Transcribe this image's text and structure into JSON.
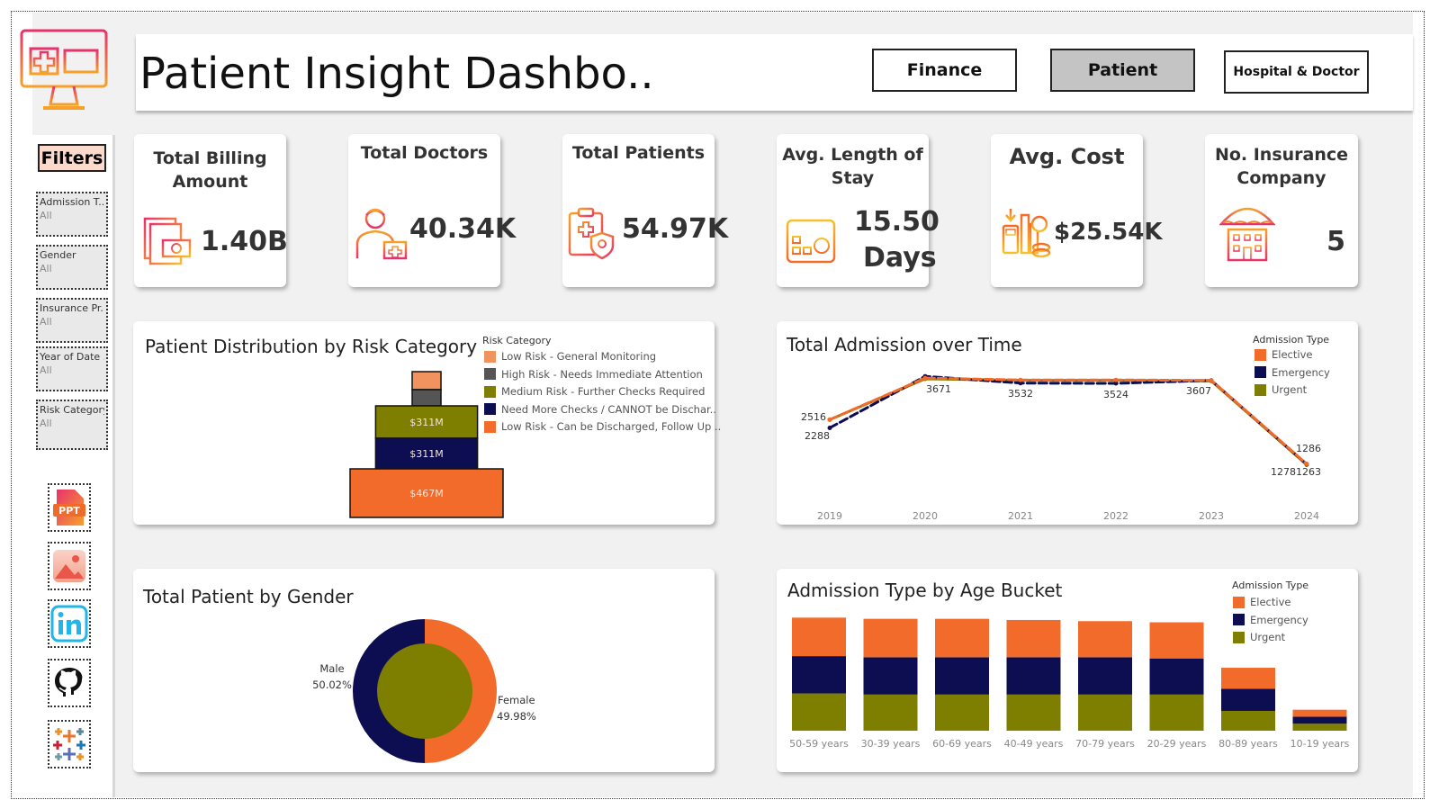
{
  "header": {
    "title": "Patient Insight Dashbo..",
    "nav": [
      {
        "label": "Finance",
        "bg": "#fbd9cb"
      },
      {
        "label": "Patient",
        "bg": "#c4c4c4"
      },
      {
        "label": "Hospital & Doctor",
        "bg": "#fbd9cb"
      }
    ]
  },
  "sidebar": {
    "filters_title": "Filters",
    "filters": [
      {
        "label": "Admission T..",
        "value": "All"
      },
      {
        "label": "Gender",
        "value": "All"
      },
      {
        "label": "Insurance Pr..",
        "value": "All"
      },
      {
        "label": "Year of Date ..",
        "value": "All"
      },
      {
        "label": "Risk Category",
        "value": "All"
      }
    ],
    "links": [
      "ppt-icon",
      "image-icon",
      "linkedin-icon",
      "github-icon",
      "tableau-icon"
    ]
  },
  "kpis": [
    {
      "label": "Total Billing Amount",
      "value": "1.40B",
      "icon": "billing-icon"
    },
    {
      "label": "Total Doctors",
      "value": "40.34K",
      "icon": "doctor-icon"
    },
    {
      "label": "Total Patients",
      "value": "54.97K",
      "icon": "patient-icon"
    },
    {
      "label": "Avg. Length of Stay",
      "value": "15.50",
      "value2": "Days",
      "icon": "calendar-icon"
    },
    {
      "label": "Avg. Cost",
      "value": "$25.54K",
      "icon": "cost-icon"
    },
    {
      "label": "No. Insurance Company",
      "value": "5",
      "icon": "insurance-icon"
    }
  ],
  "colors": {
    "orange": "#f26b2a",
    "light_orange": "#f0935e",
    "gray": "#555555",
    "olive": "#7e7e00",
    "navy": "#0d0d52"
  },
  "chart_data": [
    {
      "type": "bar",
      "title": "Patient Distribution by Risk Category",
      "legend_title": "Risk Category",
      "categories": [
        "Low Risk - General Monitoring",
        "High Risk - Needs Immediate Attention",
        "Medium Risk - Further Checks Required",
        "Need More Checks / CANNOT be Dischar..",
        "Low Risk - Can be Discharged, Follow Up .."
      ],
      "colors": [
        "#f0935e",
        "#555555",
        "#7e7e00",
        "#0d0d52",
        "#f26b2a"
      ],
      "values": [
        88,
        88,
        311,
        311,
        467
      ],
      "labels": [
        "",
        "",
        "$311M",
        "$311M",
        "$467M"
      ],
      "unit": "$M"
    },
    {
      "type": "line",
      "title": "Total Admission over Time",
      "legend_title": "Admission Type",
      "x": [
        "2019",
        "2020",
        "2021",
        "2022",
        "2023",
        "2024"
      ],
      "series": [
        {
          "name": "Elective",
          "color": "#f26b2a",
          "values": [
            2516,
            3671,
            3620,
            3620,
            3607,
            1286
          ]
        },
        {
          "name": "Emergency",
          "color": "#0d0d52",
          "values": [
            2288,
            3720,
            3532,
            3524,
            3607,
            1278
          ]
        },
        {
          "name": "Urgent",
          "color": "#7e7e00",
          "values": [
            2516,
            3650,
            3610,
            3610,
            3590,
            1263
          ]
        }
      ],
      "point_labels": [
        {
          "x": "2019",
          "text": "2516"
        },
        {
          "x": "2019",
          "text": "2288"
        },
        {
          "x": "2020",
          "text": "3671"
        },
        {
          "x": "2021",
          "text": "3532"
        },
        {
          "x": "2022",
          "text": "3524"
        },
        {
          "x": "2023",
          "text": "3607"
        },
        {
          "x": "2024",
          "text": "1286"
        },
        {
          "x": "2024",
          "text": "12781263"
        }
      ],
      "ylim": [
        1000,
        4000
      ]
    },
    {
      "type": "pie",
      "title": "Total Patient by Gender",
      "slices": [
        {
          "label": "Male",
          "pct_text": "50.02%",
          "value": 50.02,
          "color": "#0d0d52"
        },
        {
          "label": "Female",
          "pct_text": "49.98%",
          "value": 49.98,
          "color": "#f26b2a"
        }
      ],
      "center_color": "#7e7e00"
    },
    {
      "type": "bar",
      "stacked": true,
      "title": "Admission Type by Age Bucket",
      "legend_title": "Admission Type",
      "categories": [
        "50-59 years",
        "30-39 years",
        "60-69 years",
        "40-49 years",
        "70-79 years",
        "20-29 years",
        "80-89 years",
        "10-19 years"
      ],
      "series": [
        {
          "name": "Urgent",
          "color": "#7e7e00",
          "values": [
            3200,
            3100,
            3100,
            3100,
            3100,
            3100,
            1700,
            600
          ]
        },
        {
          "name": "Emergency",
          "color": "#0d0d52",
          "values": [
            3200,
            3200,
            3200,
            3200,
            3200,
            3100,
            1900,
            600
          ]
        },
        {
          "name": "Elective",
          "color": "#f26b2a",
          "values": [
            3300,
            3300,
            3300,
            3200,
            3100,
            3100,
            1800,
            600
          ]
        }
      ],
      "ylim": [
        0,
        10500
      ]
    }
  ]
}
